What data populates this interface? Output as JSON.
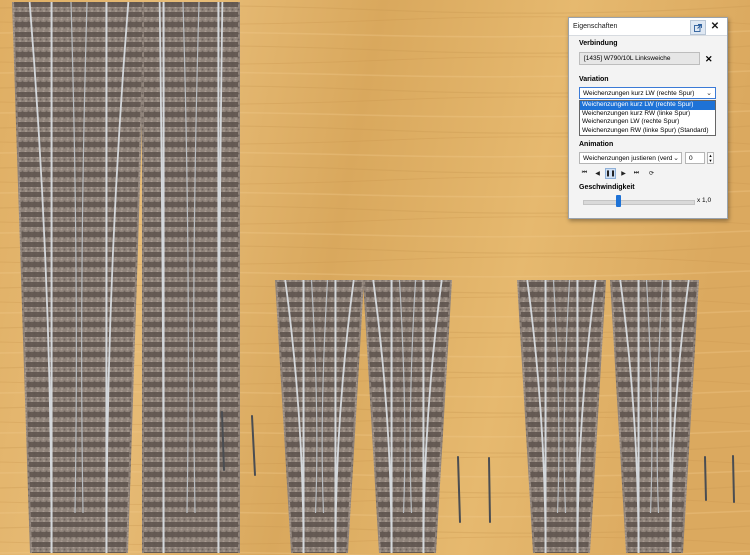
{
  "panel": {
    "title": "Eigenschaften",
    "popout_icon": "popout-icon",
    "close_icon": "close-icon",
    "verbindung": {
      "heading": "Verbindung",
      "value": "[1435] W790/10L Linksweiche",
      "clear": "✕"
    },
    "variation": {
      "heading": "Variation",
      "selected": "Weichenzungen kurz LW (rechte Spur)",
      "options": [
        "Weichenzungen kurz LW (rechte Spur)",
        "Weichenzungen kurz RW (linke Spur)",
        "Weichenzungen LW (rechte Spur)",
        "Weichenzungen RW (linke Spur) (Standard)"
      ]
    },
    "animation": {
      "heading": "Animation",
      "selected": "Weichenzungen justieren (verd",
      "value": "0",
      "controls": [
        "skip-start-icon",
        "step-back-icon",
        "pause-icon",
        "step-forward-icon",
        "skip-end-icon",
        "loop-icon"
      ]
    },
    "speed": {
      "heading": "Geschwindigkeit",
      "value_label": "x 1,0",
      "level": 0.3
    }
  },
  "colors": {
    "accent": "#1e72d6",
    "wood": "#e2b56d",
    "ballast": "#8a7d74",
    "sleeper": "#5a4f49"
  }
}
